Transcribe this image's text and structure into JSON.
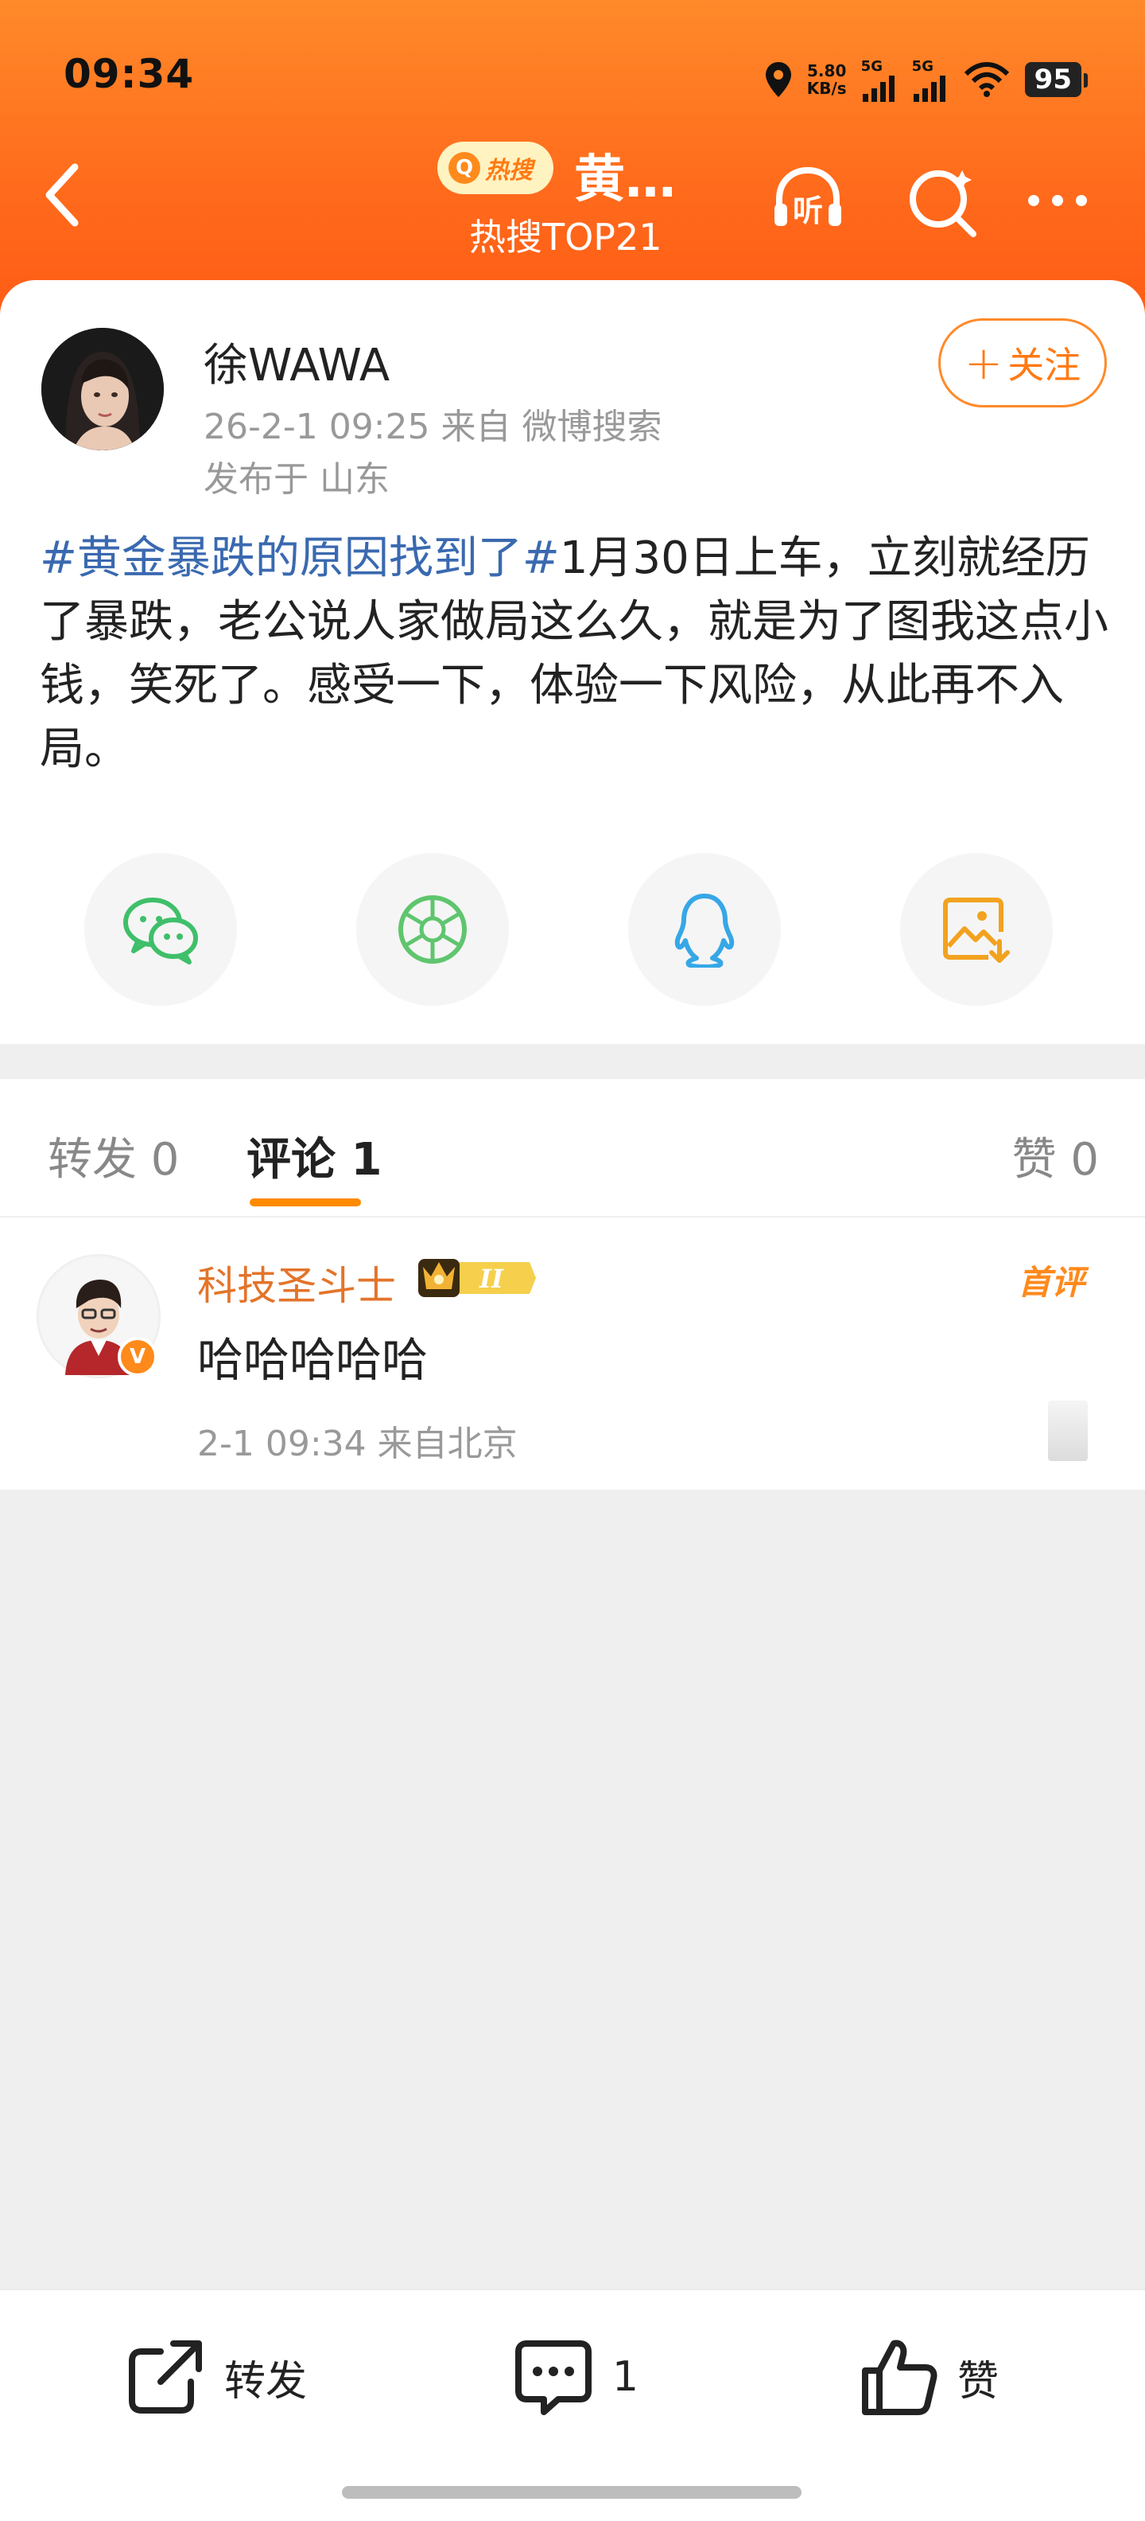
{
  "status_bar": {
    "time": "09:34",
    "net_speed_value": "5.80",
    "net_speed_unit": "KB/s",
    "signal1": "5G",
    "signal2": "5G",
    "battery": "95",
    "icons": [
      "location-icon",
      "signal-icon",
      "wifi-icon",
      "battery-icon"
    ]
  },
  "nav": {
    "hot_badge": "热搜",
    "title": "黄…",
    "subtitle": "热搜TOP21",
    "listen_label": "听",
    "icons": [
      "back-icon",
      "listen-icon",
      "search-icon",
      "more-icon"
    ]
  },
  "post": {
    "author": "徐WAWA",
    "meta": "26-2-1 09:25   来自 微博搜索",
    "location": "发布于 山东",
    "follow_label": "关注",
    "topic": "#黄金暴跌的原因找到了#",
    "body": "1月30日上车，立刻就经历了暴跌，老公说人家做局这么久，就是为了图我这点小钱，笑死了。感受一下，体验一下风险，从此再不入局。",
    "share_targets": [
      "wechat-icon",
      "moments-icon",
      "qq-icon",
      "save-image-icon"
    ]
  },
  "tabs": {
    "repost": "转发 0",
    "comment": "评论 1",
    "like": "赞 0"
  },
  "comments": [
    {
      "name": "科技圣斗士",
      "level_badge": "II",
      "first_badge": "首评",
      "text": "哈哈哈哈哈",
      "meta": "2-1 09:34  来自北京"
    }
  ],
  "bottom_bar": {
    "repost_label": "转发",
    "comment_count": "1",
    "like_label": "赞"
  },
  "colors": {
    "header_orange": "#ff6b1c",
    "accent_orange": "#ff8a2a",
    "topic_blue": "#3a69b0",
    "comment_name": "#e3742b"
  }
}
